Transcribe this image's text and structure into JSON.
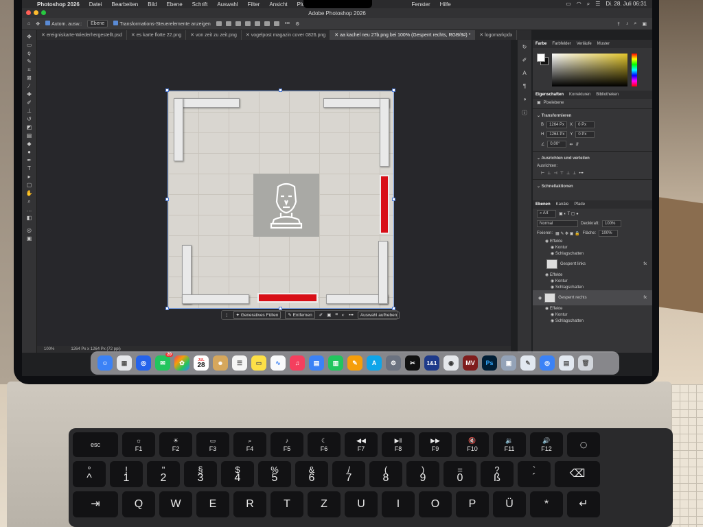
{
  "menubar": {
    "app": "Photoshop 2026",
    "items": [
      "Datei",
      "Bearbeiten",
      "Bild",
      "Ebene",
      "Schrift",
      "Auswahl",
      "Filter",
      "Ansicht",
      "Plug-ins",
      "Fenster",
      "Hilfe"
    ],
    "clock": "Di. 28. Juli 06:31"
  },
  "window": {
    "title": "Adobe Photoshop 2026"
  },
  "options": {
    "auto_select_label": "Autom. ausw.:",
    "auto_select_value": "Ebene",
    "transform_label": "Transformations-Steuerelemente anzeigen"
  },
  "tabs": [
    "ereigniskarte-Wiederhergestellt.psd",
    "es karte flotte 22.png",
    "von zeit zu zeit.png",
    "vogelpost magazin cover 0826.png",
    "aa kachel neu 27b.png bei 100% (Gesperrt rechts, RGB/8#) *",
    "logomarkpdx"
  ],
  "context_bar": {
    "generative_fill": "Generatives Füllen",
    "remove": "Entfernen",
    "deselect": "Auswahl aufheben"
  },
  "status": {
    "zoom": "100%",
    "size": "1264 Px x 1264 Px (72 ppi)"
  },
  "panels": {
    "color_tabs": [
      "Farbe",
      "Farbfelder",
      "Verläufe",
      "Muster"
    ],
    "properties_tabs": [
      "Eigenschaften",
      "Korrekturen",
      "Bibliotheken"
    ],
    "pixel_layer": "Pixelebene",
    "transform_title": "Transformieren",
    "w_label": "B",
    "w_value": "1264 Px",
    "h_label": "H",
    "h_value": "1264 Px",
    "x_label": "X",
    "x_value": "0 Px",
    "y_label": "Y",
    "y_value": "0 Px",
    "angle_value": "0,00°",
    "align_title": "Ausrichten und verteilen",
    "align_label": "Ausrichten:",
    "quick_actions": "Schnellaktionen",
    "layers_tabs": [
      "Ebenen",
      "Kanäle",
      "Pfade"
    ],
    "kind": "Art",
    "blend_mode": "Normal",
    "opacity_label": "Deckkraft:",
    "opacity_value": "100%",
    "lock_label": "Fixieren:",
    "fill_label": "Fläche:",
    "fill_value": "100%",
    "effects": "Effekte",
    "stroke": "Kontur",
    "shadow": "Schlagschatten",
    "layer_locked_left": "Gesperrt links",
    "layer_locked_right": "Gesperrt rechts"
  },
  "dock": {
    "calendar_month": "JUL",
    "calendar_day": "28",
    "messages_badge": "20"
  },
  "keyboard": {
    "esc": "esc",
    "f_keys": [
      "F1",
      "F2",
      "F3",
      "F4",
      "F5",
      "F6",
      "F7",
      "F8",
      "F9",
      "F10",
      "F11",
      "F12"
    ],
    "num_top": [
      "°",
      "!",
      "\"",
      "§",
      "$",
      "%",
      "&",
      "/",
      "(",
      ")",
      "=",
      "?",
      "`"
    ],
    "num_bottom": [
      "^",
      "1",
      "2",
      "3",
      "4",
      "5",
      "6",
      "7",
      "8",
      "9",
      "0",
      "ß",
      "´"
    ],
    "row3": [
      "Q",
      "W",
      "E",
      "R",
      "T",
      "Z",
      "U",
      "I",
      "O",
      "P",
      "Ü",
      "*"
    ]
  },
  "colors": {
    "accent": "#3b82f6",
    "red_bar": "#d80f17"
  }
}
